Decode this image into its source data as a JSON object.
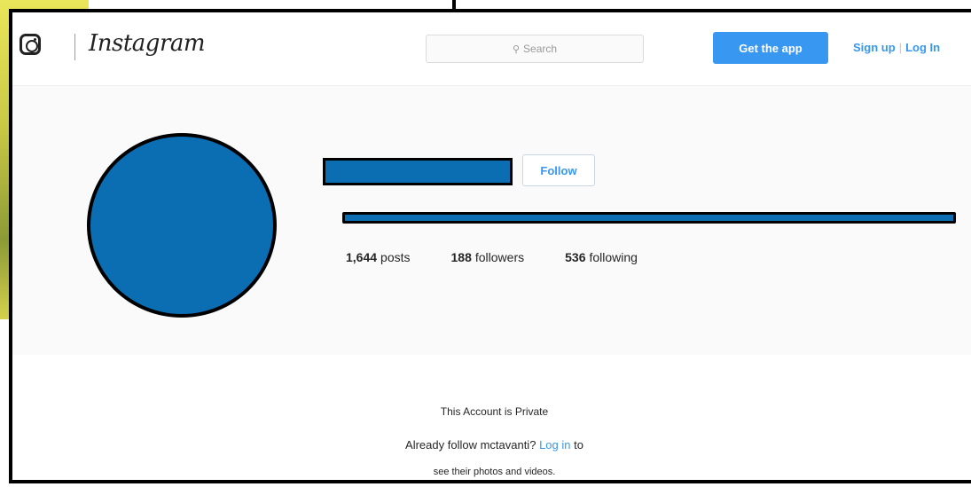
{
  "header": {
    "wordmark": "Instagram",
    "search_placeholder": "Search",
    "get_app_label": "Get the app",
    "signup_label": "Sign up",
    "separator": "|",
    "login_label": "Log In"
  },
  "profile": {
    "follow_label": "Follow",
    "stats": [
      {
        "value": "1,644",
        "label": "posts"
      },
      {
        "value": "188",
        "label": "followers"
      },
      {
        "value": "536",
        "label": "following"
      }
    ]
  },
  "private": {
    "title": "This Account is Private",
    "message_prefix": "Already follow mctavanti?",
    "login_link": "Log in",
    "message_suffix": "to",
    "subtext": "see their photos and videos."
  },
  "colors": {
    "accent": "#3897f0",
    "redaction": "#0b6db2"
  },
  "icons": [
    "instagram-logo-icon",
    "search-icon"
  ]
}
